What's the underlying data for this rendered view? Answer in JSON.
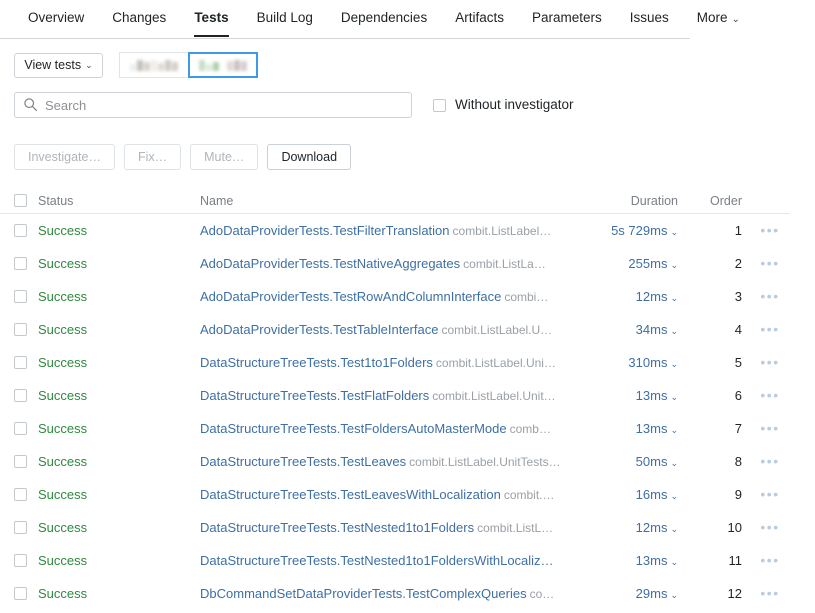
{
  "tabs": [
    {
      "label": "Overview",
      "active": false,
      "caret": ""
    },
    {
      "label": "Changes",
      "active": false,
      "caret": ""
    },
    {
      "label": "Tests",
      "active": true,
      "caret": ""
    },
    {
      "label": "Build Log",
      "active": false,
      "caret": ""
    },
    {
      "label": "Dependencies",
      "active": false,
      "caret": ""
    },
    {
      "label": "Artifacts",
      "active": false,
      "caret": ""
    },
    {
      "label": "Parameters",
      "active": false,
      "caret": ""
    },
    {
      "label": "Issues",
      "active": false,
      "caret": ""
    },
    {
      "label": "More",
      "active": false,
      "caret": "⌄"
    }
  ],
  "toolbar": {
    "view_tests_label": "View tests",
    "view_tests_caret": "⌄",
    "segments": [
      {
        "name": "view-mode-segment-1",
        "selected": false,
        "redacted": true
      },
      {
        "name": "view-mode-segment-2",
        "selected": true,
        "redacted": true
      }
    ]
  },
  "search": {
    "placeholder": "Search",
    "value": "",
    "icon": "search-icon"
  },
  "filters": {
    "without_investigator_label": "Without investigator",
    "without_investigator_checked": false
  },
  "actions": [
    {
      "label": "Investigate…",
      "enabled": false,
      "name": "investigate-button"
    },
    {
      "label": "Fix…",
      "enabled": false,
      "name": "fix-button"
    },
    {
      "label": "Mute…",
      "enabled": false,
      "name": "mute-button"
    },
    {
      "label": "Download",
      "enabled": true,
      "name": "download-button"
    }
  ],
  "table": {
    "columns": {
      "status": "Status",
      "name": "Name",
      "duration": "Duration",
      "order": "Order"
    },
    "select_all_checked": false,
    "row_menu_glyph": "•••",
    "duration_caret": "⌄",
    "rows": [
      {
        "status": "Success",
        "name": "AdoDataProviderTests.TestFilterTranslation",
        "name_suffix": "combit.ListLabel…",
        "duration": "5s 729ms",
        "order": "1",
        "checked": false
      },
      {
        "status": "Success",
        "name": "AdoDataProviderTests.TestNativeAggregates",
        "name_suffix": "combit.ListLa…",
        "duration": "255ms",
        "order": "2",
        "checked": false
      },
      {
        "status": "Success",
        "name": "AdoDataProviderTests.TestRowAndColumnInterface",
        "name_suffix": "combi…",
        "duration": "12ms",
        "order": "3",
        "checked": false
      },
      {
        "status": "Success",
        "name": "AdoDataProviderTests.TestTableInterface",
        "name_suffix": "combit.ListLabel.U…",
        "duration": "34ms",
        "order": "4",
        "checked": false
      },
      {
        "status": "Success",
        "name": "DataStructureTreeTests.Test1to1Folders",
        "name_suffix": "combit.ListLabel.Uni…",
        "duration": "310ms",
        "order": "5",
        "checked": false
      },
      {
        "status": "Success",
        "name": "DataStructureTreeTests.TestFlatFolders",
        "name_suffix": "combit.ListLabel.Unit…",
        "duration": "13ms",
        "order": "6",
        "checked": false
      },
      {
        "status": "Success",
        "name": "DataStructureTreeTests.TestFoldersAutoMasterMode",
        "name_suffix": "comb…",
        "duration": "13ms",
        "order": "7",
        "checked": false
      },
      {
        "status": "Success",
        "name": "DataStructureTreeTests.TestLeaves",
        "name_suffix": "combit.ListLabel.UnitTests…",
        "duration": "50ms",
        "order": "8",
        "checked": false
      },
      {
        "status": "Success",
        "name": "DataStructureTreeTests.TestLeavesWithLocalization",
        "name_suffix": "combit.…",
        "duration": "16ms",
        "order": "9",
        "checked": false
      },
      {
        "status": "Success",
        "name": "DataStructureTreeTests.TestNested1to1Folders",
        "name_suffix": "combit.ListL…",
        "duration": "12ms",
        "order": "10",
        "checked": false
      },
      {
        "status": "Success",
        "name": "DataStructureTreeTests.TestNested1to1FoldersWithLocaliz…",
        "name_suffix": "",
        "duration": "13ms",
        "order": "11",
        "checked": false
      },
      {
        "status": "Success",
        "name": "DbCommandSetDataProviderTests.TestComplexQueries",
        "name_suffix": "co…",
        "duration": "29ms",
        "order": "12",
        "checked": false
      }
    ]
  },
  "colors": {
    "success_green": "#2f8a3f",
    "link_blue": "#3e6fa5",
    "selected_border": "#3e9ae8",
    "muted_grey": "#9aa0a6"
  }
}
